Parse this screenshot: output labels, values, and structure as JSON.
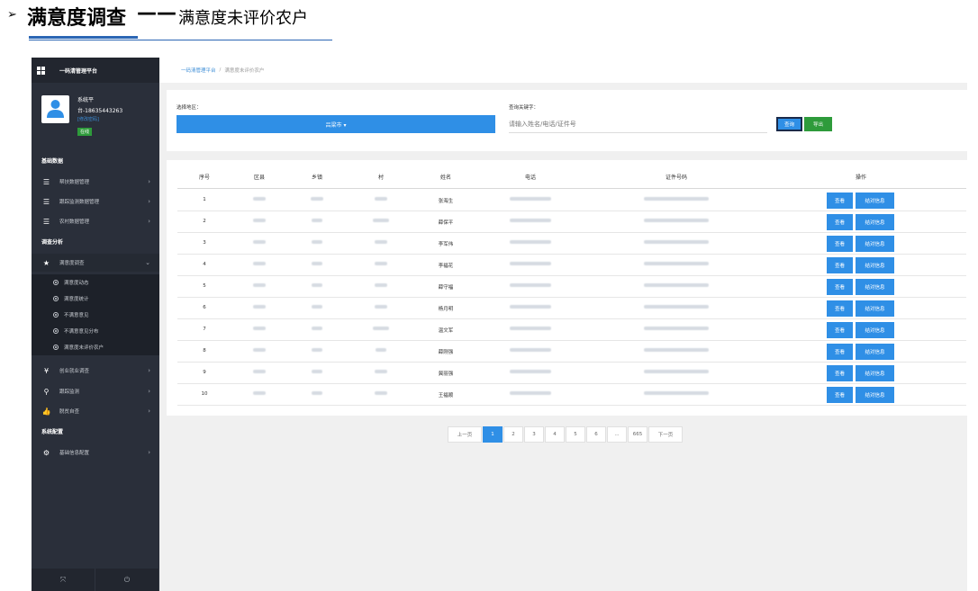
{
  "slide": {
    "bullet": "➢",
    "title": "满意度调查",
    "dash": "——",
    "subtitle": "满意度未评价农户"
  },
  "sidebar": {
    "app_title": "一码清管理平台",
    "user": {
      "name": "系统平",
      "phone": "台-18635443263",
      "change_password": "[修改密码]",
      "status": "在线"
    },
    "sections": {
      "basic": "基础数据",
      "survey": "调查分析",
      "system": "系统配置"
    },
    "items": {
      "assist": "帮扶数据管理",
      "track": "跟踪监测数据管理",
      "village": "农村数据管理",
      "satisfaction": "满意度调查",
      "employment": "创业就业调查",
      "monitor": "跟踪监测",
      "poverty": "脱贫自查",
      "config": "基础信息配置"
    },
    "sub_items": [
      "满意度动态",
      "满意度统计",
      "不满意意见",
      "不满意意见分布",
      "满意度未评价农户"
    ]
  },
  "breadcrumb": {
    "root": "一码清管理平台",
    "sep": "/",
    "current": "满意度未评价农户"
  },
  "filter": {
    "region_label": "选择地区：",
    "region_value": "吕梁市 ▾",
    "keyword_label": "查询关键字：",
    "keyword_placeholder": "请输入姓名/电话/证件号",
    "search_button": "查询",
    "export_button": "导出"
  },
  "table": {
    "headers": [
      "序号",
      "区县",
      "乡镇",
      "村",
      "姓名",
      "电话",
      "证件号码",
      "操作"
    ],
    "rows": [
      {
        "no": "1",
        "name": "张海生"
      },
      {
        "no": "2",
        "name": "薛保平"
      },
      {
        "no": "3",
        "name": "李军伟"
      },
      {
        "no": "4",
        "name": "李福花"
      },
      {
        "no": "5",
        "name": "薛守福"
      },
      {
        "no": "6",
        "name": "杨月明"
      },
      {
        "no": "7",
        "name": "温文军"
      },
      {
        "no": "8",
        "name": "薛刚强"
      },
      {
        "no": "9",
        "name": "冀丽强"
      },
      {
        "no": "10",
        "name": "王福顺"
      }
    ],
    "view_label": "查看",
    "pair_label": "结对信息"
  },
  "pagination": {
    "prev": "上一页",
    "pages": [
      "1",
      "2",
      "3",
      "4",
      "5",
      "6",
      "...",
      "665"
    ],
    "current": "1",
    "next": "下一页"
  },
  "colors": {
    "primary": "#2f8fe6",
    "success": "#2e9b3b",
    "sidebar": "#2a2f3a"
  }
}
